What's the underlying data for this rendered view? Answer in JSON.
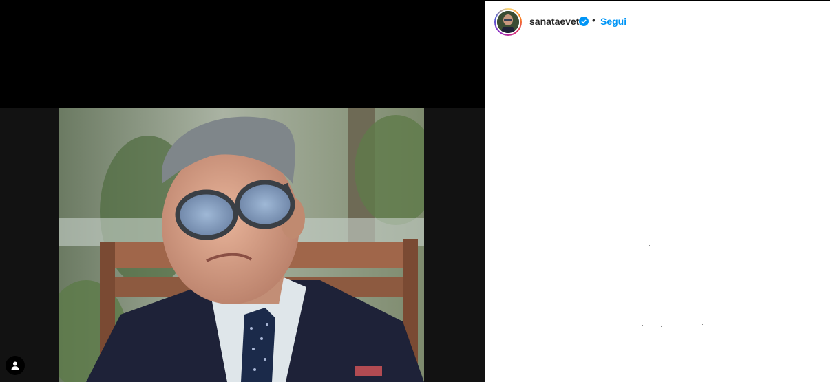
{
  "post": {
    "username": "sanataevet",
    "verified": true,
    "separator": "•",
    "follow_label": "Segui"
  },
  "media": {
    "tag_icon": "user-tag-icon"
  },
  "colors": {
    "follow_blue": "#0095f6",
    "verified_blue": "#0095f6",
    "text_dark": "#262626"
  }
}
